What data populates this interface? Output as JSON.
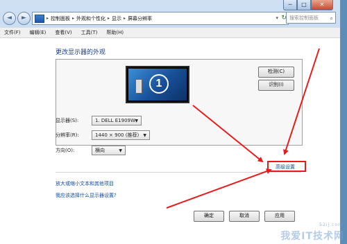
{
  "window": {
    "min_label": "─",
    "max_label": "□",
    "close_label": "✕"
  },
  "nav": {
    "back": "◄",
    "forward": "►",
    "breadcrumbs": [
      "控制面板",
      "外观和个性化",
      "显示",
      "屏幕分辨率"
    ],
    "breadcrumb_sep": "▸",
    "refresh": "↻",
    "dropdown": "▾",
    "search_placeholder": "搜索控制面板",
    "search_icon": "⌕"
  },
  "menu": [
    "文件(F)",
    "编辑(E)",
    "查看(V)",
    "工具(T)",
    "帮助(H)"
  ],
  "page": {
    "title": "更改显示器的外观",
    "monitor_number": "1",
    "detect_button": "检测(C)",
    "identify_button": "识别(I)"
  },
  "form": {
    "display_label": "显示器(S):",
    "display_value": "1. DELL E1909W",
    "resolution_label": "分辨率(R):",
    "resolution_value": "1440 × 900 (推荐)",
    "orientation_label": "方向(O):",
    "orientation_value": "横向",
    "dropdown_arrow": "▼"
  },
  "links": {
    "advanced": "高级设置",
    "text_size": "放大或缩小文本和其他项目",
    "help": "我应该选择什么显示器设置?"
  },
  "footer": {
    "ok": "确定",
    "cancel": "取消",
    "apply": "应用"
  },
  "watermark": {
    "text": "我爱IT技术网",
    "sub": "52ij.com"
  },
  "colors": {
    "accent_red": "#ea1a1a",
    "link_blue": "#0a4aa8",
    "title_blue": "#1a3e8c"
  }
}
